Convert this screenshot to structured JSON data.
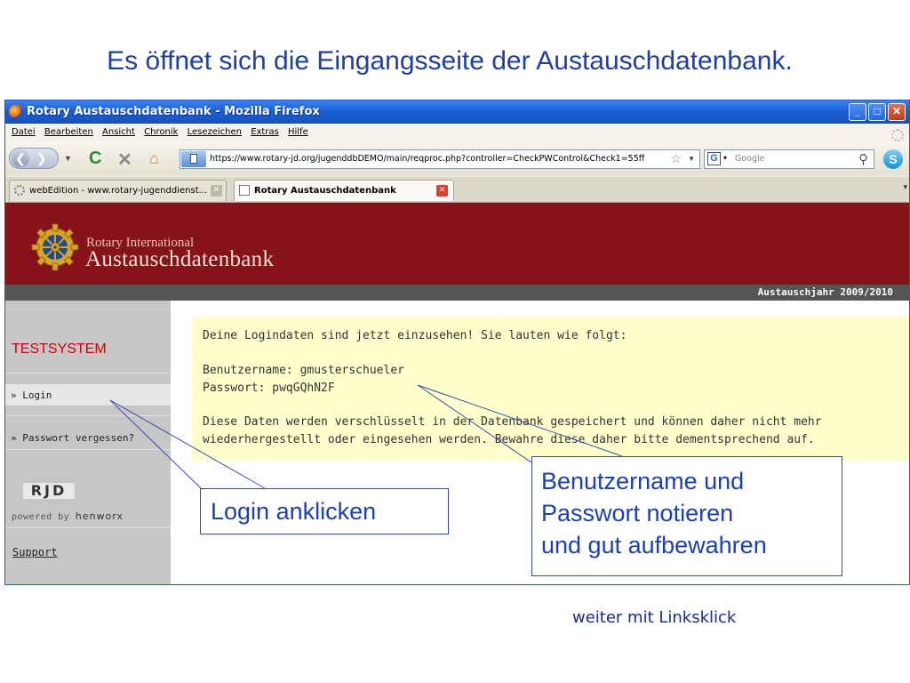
{
  "slide_title": "Es öffnet sich die Eingangsseite der Austauschdatenbank.",
  "browser": {
    "window_title": "Rotary Austauschdatenbank - Mozilla Firefox",
    "menu": [
      "Datei",
      "Bearbeiten",
      "Ansicht",
      "Chronik",
      "Lesezeichen",
      "Extras",
      "Hilfe"
    ],
    "url": "https://www.rotary-jd.org/jugenddbDEMO/main/reqproc.php?controller=CheckPWControl&Check1=55ff",
    "search_placeholder": "Google",
    "search_engine_icon": "G",
    "tabs": [
      {
        "label": "webEdition - www.rotary-jugenddienst...",
        "active": false
      },
      {
        "label": "Rotary Austauschdatenbank",
        "active": true
      }
    ]
  },
  "site": {
    "brand_small": "Rotary International",
    "brand_big": "Austauschdatenbank",
    "exchange_year": "Austauschjahr 2009/2010",
    "sidebar": {
      "system_label": "TESTSYSTEM",
      "nav": [
        "» Login",
        "» Passwort vergessen?"
      ],
      "rjd": "RJD",
      "powered_prefix": "powered by",
      "powered_name": "henworx",
      "support": "Support"
    },
    "info": {
      "line1": "Deine Logindaten sind jetzt einzusehen! Sie lauten wie folgt:",
      "line2": "Benutzername: gmusterschueler",
      "line3": "Passwort: pwqGQhN2F",
      "line4": "Diese Daten werden verschlüsselt in der Datenbank gespeichert und können daher nicht mehr",
      "line5": "wiederhergestellt oder eingesehen werden. Bewahre diese daher bitte dementsprechend auf."
    }
  },
  "callouts": {
    "login": "Login anklicken",
    "cred_line1": "Benutzername und",
    "cred_line2": "Passwort notieren",
    "cred_line3": "und gut aufbewahren"
  },
  "footer_note": "weiter mit Linksklick",
  "colors": {
    "title_blue": "#1f3fa8",
    "header_red": "#86121c",
    "testsystem_red": "#d40000",
    "info_yellow": "#ffffce",
    "callout_blue": "#1d3fb5"
  }
}
